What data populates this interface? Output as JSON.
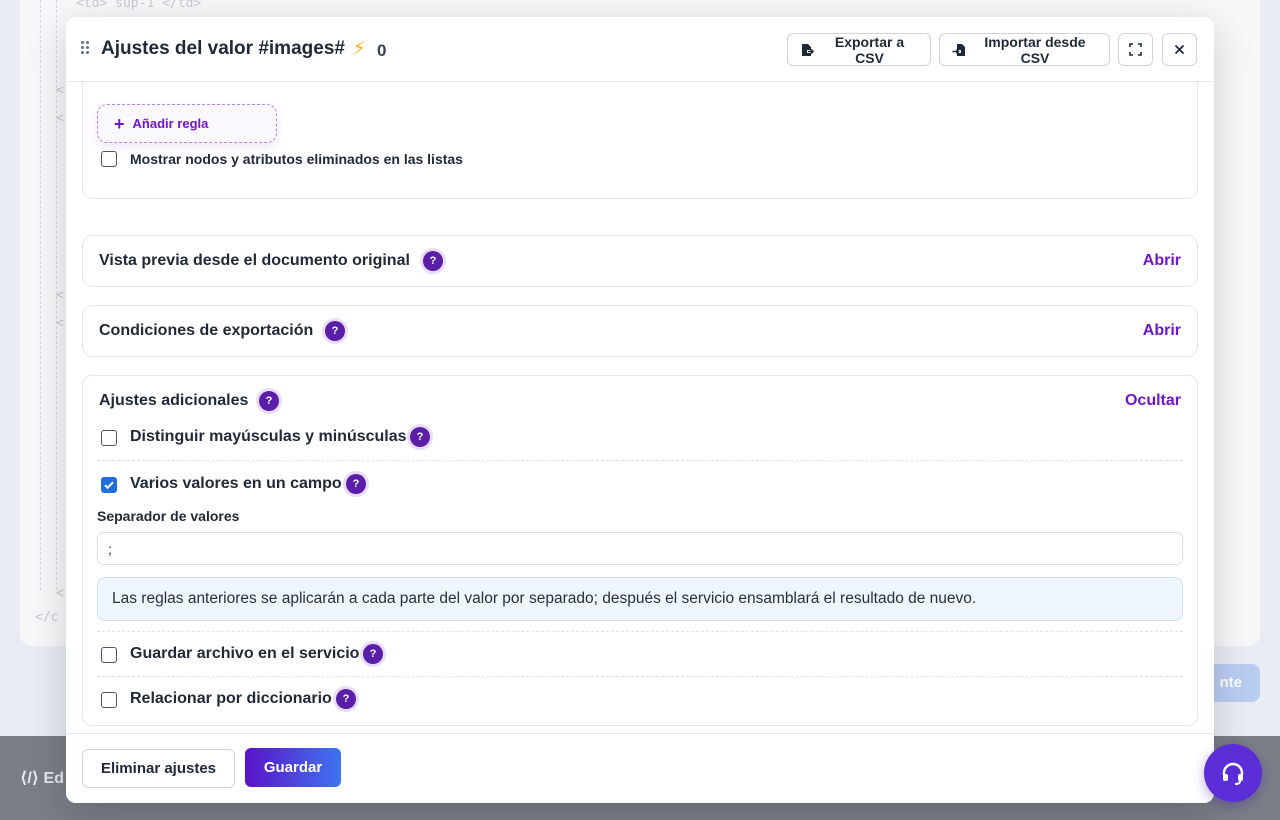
{
  "background": {
    "code_snippet": "<td> sup-1 </td>",
    "closing_tag": "</c",
    "footer_logo": "⟨/⟩ Ed",
    "next_button_label": "nte"
  },
  "modal": {
    "title": "Ajustes del valor #images#",
    "count": "0",
    "header_buttons": {
      "export_label": "Exportar a CSV",
      "import_label": "Importar desde CSV"
    },
    "rules": {
      "add_rule_label": "Añadir regla",
      "show_deleted_label": "Mostrar nodos y atributos eliminados en las listas",
      "show_deleted_checked": false
    },
    "sections": [
      {
        "title": "Vista previa desde el documento original",
        "action": "Abrir"
      },
      {
        "title": "Condiciones de exportación",
        "action": "Abrir"
      }
    ],
    "additional": {
      "title": "Ajustes adicionales",
      "action": "Ocultar",
      "options": [
        {
          "label": "Distinguir mayúsculas y minúsculas",
          "checked": false
        },
        {
          "label": "Varios valores en un campo",
          "checked": true
        },
        {
          "label": "Guardar archivo en el servicio",
          "checked": false
        },
        {
          "label": "Relacionar por diccionario",
          "checked": false
        }
      ],
      "separator_label": "Separador de valores",
      "separator_value": ";",
      "info_text": "Las reglas anteriores se aplicarán a cada parte del valor por separado; después el servicio ensamblará el resultado de nuevo."
    },
    "footer": {
      "delete_label": "Eliminar ajustes",
      "save_label": "Guardar"
    }
  },
  "colors": {
    "accent": "#6d17c9",
    "help_badge": "#5a1fa8",
    "checkbox_on": "#1f6fde",
    "support": "#5a2dd6"
  },
  "icons": [
    "drag-handle-icon",
    "bolt-icon",
    "export-icon",
    "import-icon",
    "expand-icon",
    "close-icon",
    "plus-icon",
    "help-icon",
    "check-icon",
    "headset-icon"
  ]
}
